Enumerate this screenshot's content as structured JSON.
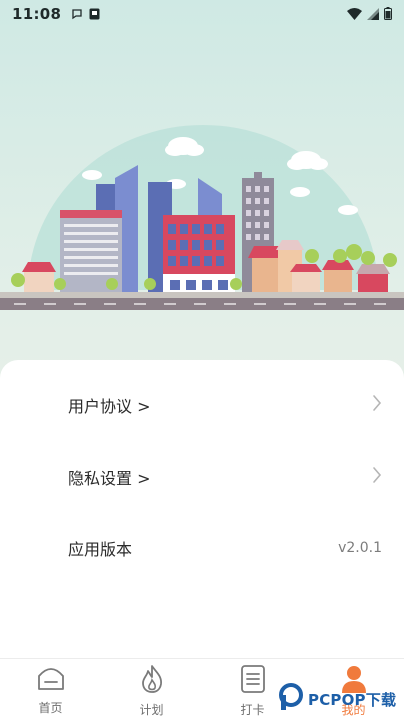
{
  "status_bar": {
    "time": "11:08",
    "left_icons": [
      "chat-bubble-icon",
      "app-badge-icon"
    ],
    "right_icons": [
      "wifi-icon",
      "cell-signal-icon",
      "battery-icon"
    ]
  },
  "menu": {
    "items": [
      {
        "label": "用户协议 >",
        "icon": "chevron-right-icon"
      },
      {
        "label": "隐私设置 >",
        "icon": "chevron-right-icon"
      },
      {
        "label": "应用版本",
        "value": "v2.0.1"
      }
    ]
  },
  "tabs": [
    {
      "label": "首页",
      "icon": "home-icon"
    },
    {
      "label": "计划",
      "icon": "flame-icon"
    },
    {
      "label": "打卡",
      "icon": "checklist-icon"
    },
    {
      "label": "我的",
      "icon": "person-icon",
      "active": true
    }
  ],
  "watermark": {
    "text": "PCPOP下载"
  },
  "colors": {
    "accent": "#f07a3c",
    "card_bg": "#ffffff",
    "sky_top": "#cfe9e4",
    "text_primary": "#2b2b2b",
    "text_secondary": "#7c7c7c"
  }
}
